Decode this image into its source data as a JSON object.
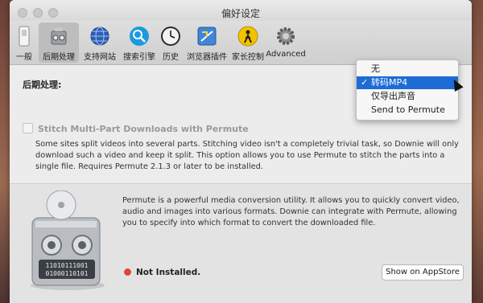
{
  "window": {
    "title": "偏好设定"
  },
  "toolbar": {
    "items": [
      {
        "label": "一般",
        "icon": "switch-icon"
      },
      {
        "label": "后期处理",
        "icon": "robot-icon",
        "selected": true
      },
      {
        "label": "支持网站",
        "icon": "globe-icon"
      },
      {
        "label": "搜索引擎",
        "icon": "magnifier-icon"
      },
      {
        "label": "历史",
        "icon": "clock-icon"
      },
      {
        "label": "浏览器插件",
        "icon": "plugin-icon"
      },
      {
        "label": "家长控制",
        "icon": "parental-icon"
      },
      {
        "label": "Advanced",
        "icon": "gear-icon"
      }
    ]
  },
  "postprocess": {
    "section_label": "后期处理:",
    "dropdown": {
      "options": [
        "无",
        "转码MP4",
        "仅导出声音",
        "Send to Permute"
      ],
      "selected_index": 1,
      "check_mark": "✓"
    },
    "stitch_checkbox_label": "Stitch Multi-Part Downloads with Permute",
    "stitch_checked": false,
    "description": "Some sites split videos into several parts. Stitching video isn't a completely trivial task, so Downie will only download such a video and keep it split. This option allows you to use Permute to stitch the parts into a single file. Requires Permute 2.1.3 or later to be installed."
  },
  "permute": {
    "description": "Permute is a powerful media conversion utility. It allows you to quickly convert video, audio and images into various formats. Downie can integrate with Permute, allowing you to specify into which format to convert the downloaded file.",
    "status_text": "Not Installed.",
    "status_color": "#e0443e",
    "button_label": "Show on AppStore",
    "icon_binary_line1": "11010111001",
    "icon_binary_line2": "01000110101"
  },
  "colors": {
    "accent": "#1d6cd5"
  }
}
